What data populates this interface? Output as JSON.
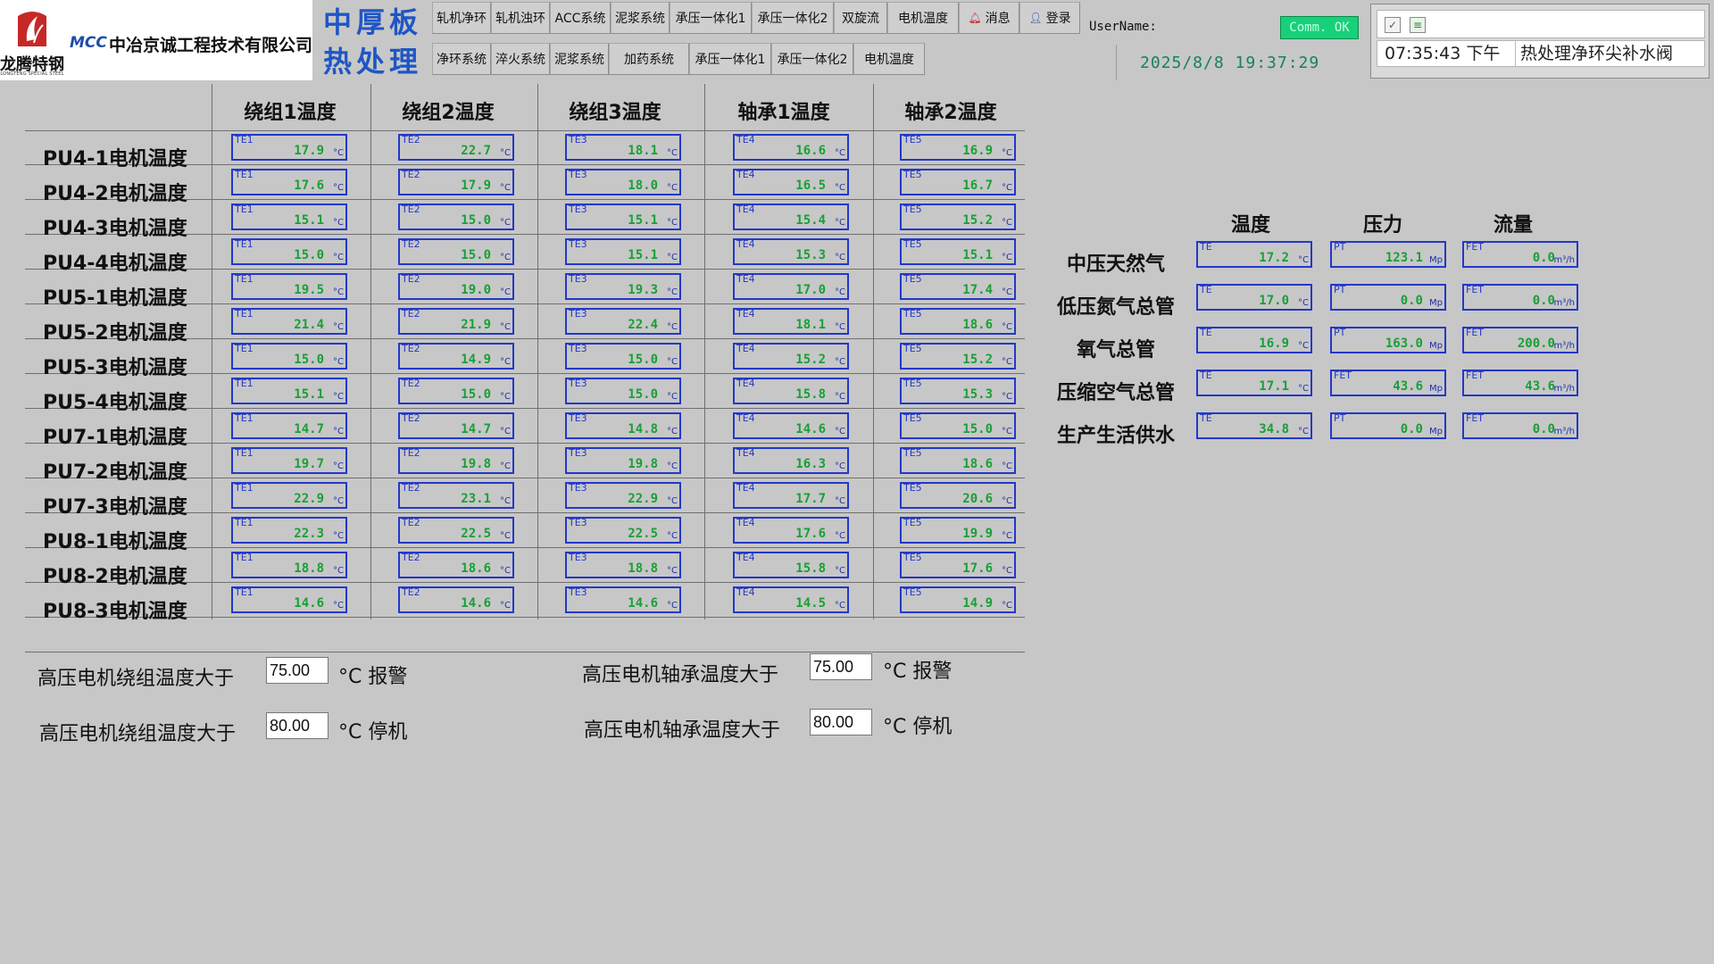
{
  "header": {
    "logo_text": "龙腾特钢",
    "logo_subtext": "LONGTENG SPECIAL STEEL",
    "mcc": "MCC",
    "company": "中冶京诚工程技术有限公司",
    "title_1": "中厚板",
    "title_2": "热处理",
    "nav_row1": [
      "轧机净环",
      "轧机浊环",
      "ACC系统",
      "泥浆系统",
      "承压一体化1",
      "承压一体化2",
      "双旋流",
      "电机温度",
      "消息",
      "登录"
    ],
    "nav_row2": [
      "净环系统",
      "淬火系统",
      "泥浆系统",
      "加药系统",
      "承压一体化1",
      "承压一体化2",
      "电机温度"
    ],
    "user_label": "UserName:",
    "comm_status": "Comm. OK",
    "datetime": "2025/8/8 19:37:29",
    "colors": {
      "title": "#1f56c4",
      "comm_ok": "#17d07a",
      "datetime": "#168060"
    }
  },
  "alarm": {
    "ack_icon": "acknowledge-icon",
    "list_icon": "alarm-list-icon",
    "time": "07:35:43 下午",
    "message": "热处理净环尖补水阀"
  },
  "motor_table": {
    "columns": [
      "绕组1温度",
      "绕组2温度",
      "绕组3温度",
      "轴承1温度",
      "轴承2温度"
    ],
    "tag_ids": [
      "TE1",
      "TE2",
      "TE3",
      "TE4",
      "TE5"
    ],
    "unit": "°C",
    "rows": [
      {
        "label": "PU4-1电机温度",
        "values": [
          "17.9",
          "22.7",
          "18.1",
          "16.6",
          "16.9"
        ]
      },
      {
        "label": "PU4-2电机温度",
        "values": [
          "17.6",
          "17.9",
          "18.0",
          "16.5",
          "16.7"
        ]
      },
      {
        "label": "PU4-3电机温度",
        "values": [
          "15.1",
          "15.0",
          "15.1",
          "15.4",
          "15.2"
        ]
      },
      {
        "label": "PU4-4电机温度",
        "values": [
          "15.0",
          "15.0",
          "15.1",
          "15.3",
          "15.1"
        ]
      },
      {
        "label": "PU5-1电机温度",
        "values": [
          "19.5",
          "19.0",
          "19.3",
          "17.0",
          "17.4"
        ]
      },
      {
        "label": "PU5-2电机温度",
        "values": [
          "21.4",
          "21.9",
          "22.4",
          "18.1",
          "18.6"
        ]
      },
      {
        "label": "PU5-3电机温度",
        "values": [
          "15.0",
          "14.9",
          "15.0",
          "15.2",
          "15.2"
        ]
      },
      {
        "label": "PU5-4电机温度",
        "values": [
          "15.1",
          "15.0",
          "15.0",
          "15.8",
          "15.3"
        ]
      },
      {
        "label": "PU7-1电机温度",
        "values": [
          "14.7",
          "14.7",
          "14.8",
          "14.6",
          "15.0"
        ]
      },
      {
        "label": "PU7-2电机温度",
        "values": [
          "19.7",
          "19.8",
          "19.8",
          "16.3",
          "18.6"
        ]
      },
      {
        "label": "PU7-3电机温度",
        "values": [
          "22.9",
          "23.1",
          "22.9",
          "17.7",
          "20.6"
        ]
      },
      {
        "label": "PU8-1电机温度",
        "values": [
          "22.3",
          "22.5",
          "22.5",
          "17.6",
          "19.9"
        ]
      },
      {
        "label": "PU8-2电机温度",
        "values": [
          "18.8",
          "18.6",
          "18.8",
          "15.8",
          "17.6"
        ]
      },
      {
        "label": "PU8-3电机温度",
        "values": [
          "14.6",
          "14.6",
          "14.6",
          "14.5",
          "14.9"
        ]
      }
    ],
    "colors": {
      "border": "#2338c8",
      "value": "#18a035"
    }
  },
  "utilities": {
    "headers": [
      "温度",
      "压力",
      "流量"
    ],
    "units": [
      "°C",
      "Mp",
      "m³/h"
    ],
    "rows": [
      {
        "label": "中压天然气",
        "tags": [
          "TE",
          "PT",
          "FET"
        ],
        "values": [
          "17.2",
          "123.1",
          "0.0"
        ]
      },
      {
        "label": "低压氮气总管",
        "tags": [
          "TE",
          "PT",
          "FET"
        ],
        "values": [
          "17.0",
          "0.0",
          "0.0"
        ]
      },
      {
        "label": "氧气总管",
        "tags": [
          "TE",
          "PT",
          "FET"
        ],
        "values": [
          "16.9",
          "163.0",
          "200.0"
        ]
      },
      {
        "label": "压缩空气总管",
        "tags": [
          "TE",
          "FET",
          "FET"
        ],
        "values": [
          "17.1",
          "43.6",
          "43.6"
        ]
      },
      {
        "label": "生产生活供水",
        "tags": [
          "TE",
          "PT",
          "FET"
        ],
        "values": [
          "34.8",
          "0.0",
          "0.0"
        ]
      }
    ]
  },
  "thresholds": {
    "winding_alarm": {
      "label": "高压电机绕组温度大于",
      "value": "75.00",
      "suffix": "°C 报警"
    },
    "winding_stop": {
      "label": "高压电机绕组温度大于",
      "value": "80.00",
      "suffix": "°C 停机"
    },
    "bearing_alarm": {
      "label": "高压电机轴承温度大于",
      "value": "75.00",
      "suffix": "°C 报警"
    },
    "bearing_stop": {
      "label": "高压电机轴承温度大于",
      "value": "80.00",
      "suffix": "°C 停机"
    }
  }
}
